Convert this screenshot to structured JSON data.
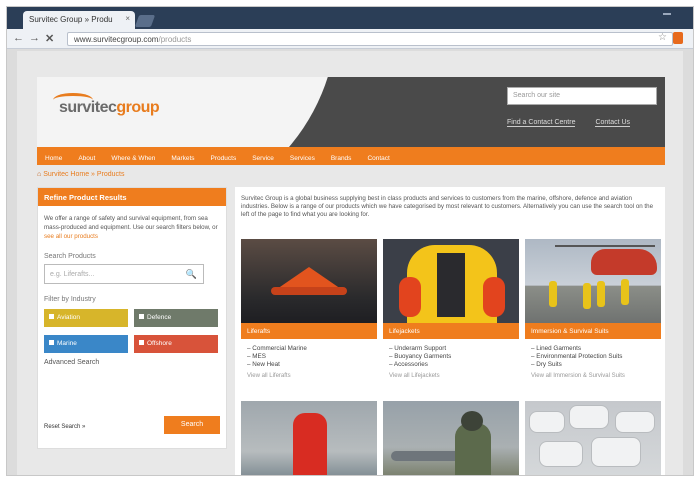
{
  "browser": {
    "tab_title": "Survitec Group » Produ",
    "tab_close": "×",
    "url_main": "www.survitecgroup.com",
    "url_path": "/products",
    "back_glyph": "←",
    "forward_glyph": "→",
    "stop_glyph": "✕",
    "star_glyph": "☆"
  },
  "header": {
    "logo_main": "survitec",
    "logo_accent": "group",
    "tagline": "",
    "search_placeholder": "Search our site",
    "links": [
      "Find a Contact Centre",
      "Contact Us"
    ]
  },
  "nav": {
    "items": [
      "Home",
      "About",
      "Where & When",
      "Markets",
      "Products",
      "Service",
      "Services",
      "Brands",
      "Contact"
    ]
  },
  "breadcrumb": {
    "home_icon": "⌂",
    "text": "Survitec Home » Products"
  },
  "sidebar": {
    "title": "Refine Product Results",
    "intro": "We offer a range of safety and survival equipment, from sea mass-produced and equipment. Use our search filters below, or",
    "intro_link": "see all our products",
    "search_label": "Search Products",
    "search_placeholder": "e.g. Liferafts...",
    "search_icon": "🔍",
    "filter_label": "Filter by Industry",
    "filters": [
      {
        "label": "Aviation",
        "color": "#d7b52a"
      },
      {
        "label": "Defence",
        "color": "#6f7a6a"
      },
      {
        "label": "Marine",
        "color": "#3a87c8"
      },
      {
        "label": "Offshore",
        "color": "#d8533a"
      }
    ],
    "advanced": "Advanced Search",
    "reset": "Reset Search »",
    "search_button": "Search"
  },
  "main": {
    "intro": "Survitec Group is a global business supplying best in class products and services to customers from the marine, offshore, defence and aviation industries. Below is a range of our products which we have categorised by most relevant to customers. Alternatively you can use the search tool on the left of the page to find what you are looking for.",
    "cards": [
      {
        "caption": "Liferafts",
        "items": [
          "Commercial Marine",
          "MES",
          "New Heat"
        ],
        "view_all": "View all Liferafts"
      },
      {
        "caption": "Lifejackets",
        "items": [
          "Underarm Support",
          "Buoyancy Garments",
          "Accessories"
        ],
        "view_all": "View all Lifejackets"
      },
      {
        "caption": "Immersion & Survival Suits",
        "items": [
          "Lined Garments",
          "Environmental Protection Suits",
          "Dry Suits"
        ],
        "view_all": "View all Immersion & Survival Suits"
      }
    ]
  }
}
